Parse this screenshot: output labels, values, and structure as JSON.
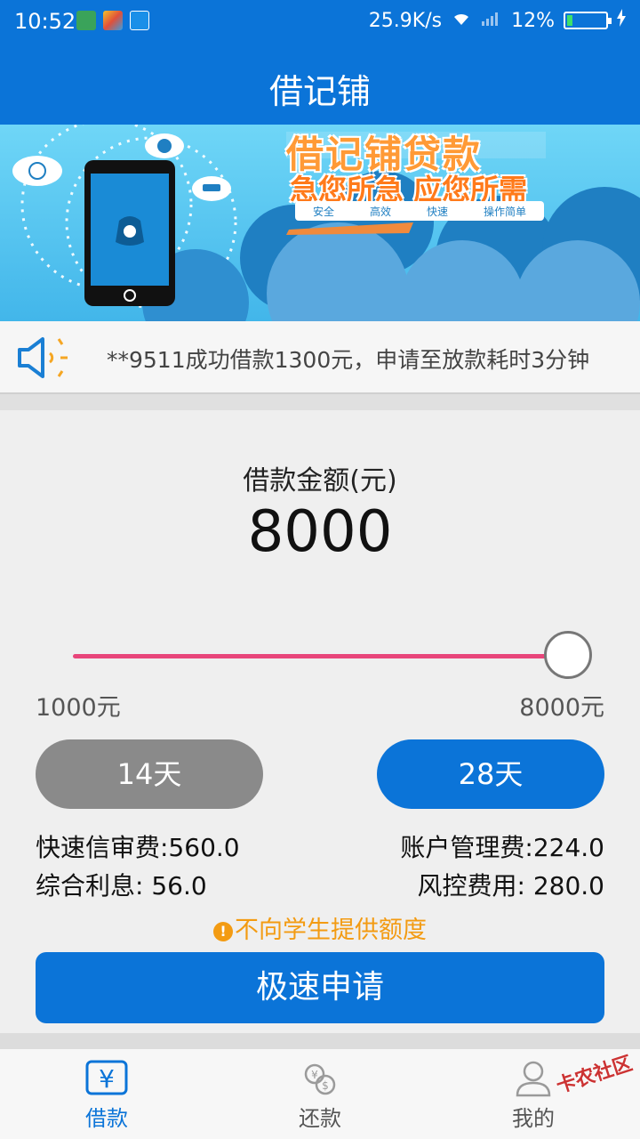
{
  "status_bar": {
    "time": "10:52",
    "network_speed": "25.9K/s",
    "battery_percent": "12%",
    "battery_level": 0.12
  },
  "header": {
    "title": "借记铺"
  },
  "banner": {
    "headline": "借记铺贷款",
    "slogan": "急您所急 应您所需",
    "tags": [
      "安全",
      "高效",
      "快速",
      "操作简单"
    ]
  },
  "notice": {
    "text": "**9511成功借款1300元，申请至放款耗时3分钟"
  },
  "loan": {
    "amount_label": "借款金额(元)",
    "amount_value": "8000",
    "slider_min_label": "1000元",
    "slider_max_label": "8000元",
    "slider_min": 1000,
    "slider_max": 8000,
    "slider_value": 8000,
    "terms": [
      {
        "label": "14天",
        "selected": false
      },
      {
        "label": "28天",
        "selected": true
      }
    ],
    "fees": {
      "quick_review": "快速信审费:560.0",
      "account_management": "账户管理费:224.0",
      "interest": "综合利息: 56.0",
      "risk_control": "风控费用: 280.0"
    },
    "warning": "不向学生提供额度",
    "apply_button": "极速申请"
  },
  "bottom_nav": {
    "loan": "借款",
    "repay": "还款",
    "mine": "我的",
    "active": "loan"
  },
  "watermark": "卡农社区",
  "colors": {
    "primary": "#0b74d8",
    "slider_track": "#e8457a",
    "warning": "#f39b12",
    "disabled_button": "#8a8a8a"
  }
}
